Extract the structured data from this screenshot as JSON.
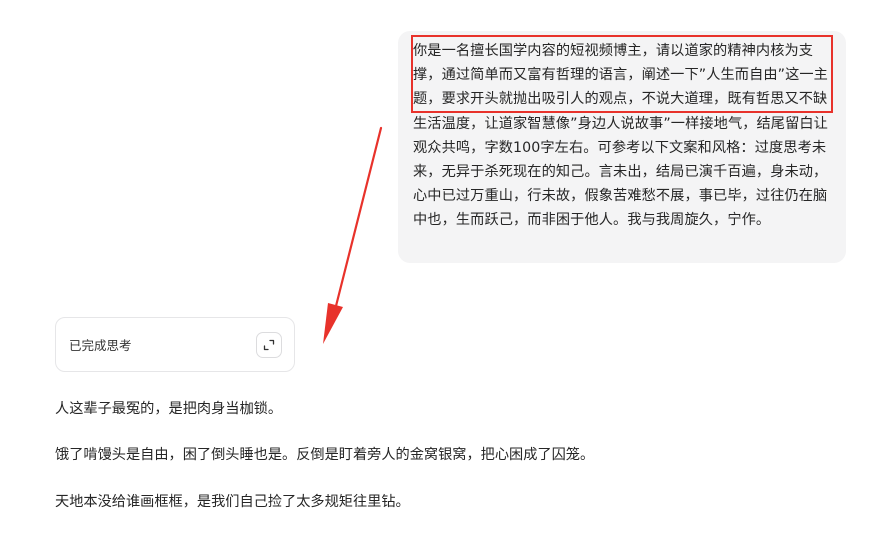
{
  "user_message": {
    "text": "你是一名擅长国学内容的短视频博主，请以道家的精神内核为支撑，通过简单而又富有哲理的语言，阐述一下”人生而自由”这一主题，要求开头就抛出吸引人的观点，不说大道理，既有哲思又不缺生活温度，让道家智慧像”身边人说故事”一样接地气，结尾留白让观众共鸣，字数100字左右。可参考以下文案和风格：过度思考未来，无异于杀死现在的知己。言未出，结局已演千百遍，身未动，心中已过万重山，行未故，假象苦难愁不展，事已毕，过往仍在脑中也，生而跃己，而非困于他人。我与我周旋久，宁作。"
  },
  "annotation": {
    "box_color": "#e8322b",
    "arrow_color": "#e8322b"
  },
  "thinking": {
    "label": "已完成思考",
    "expand_icon": "expand-icon"
  },
  "answer": {
    "paragraphs": [
      "人这辈子最冤的，是把肉身当枷锁。",
      "饿了啃馒头是自由，困了倒头睡也是。反倒是盯着旁人的金窝银窝，把心困成了囚笼。",
      "天地本没给谁画框框，是我们自己捡了太多规矩往里钻。"
    ]
  }
}
